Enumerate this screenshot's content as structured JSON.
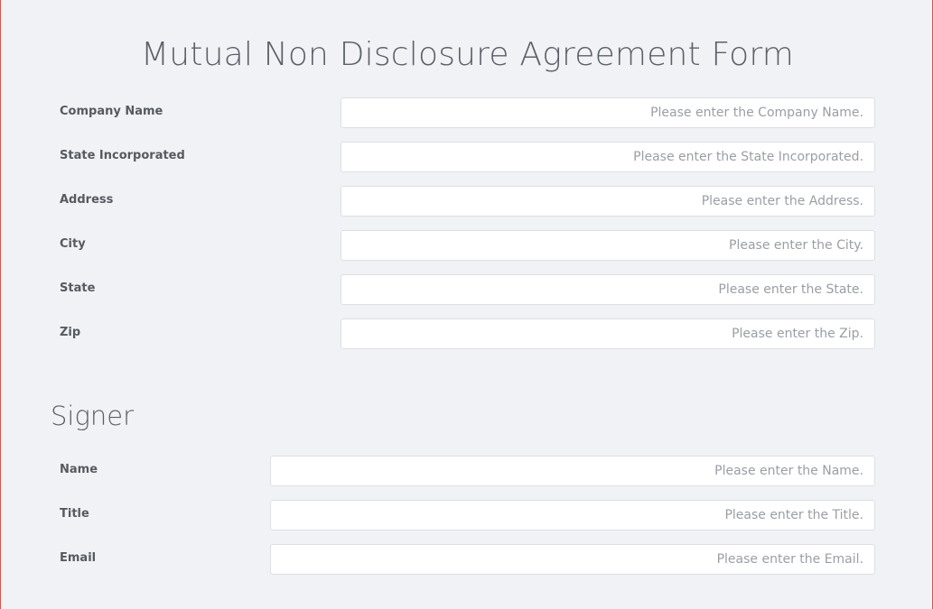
{
  "form": {
    "title": "Mutual Non Disclosure Agreement Form",
    "company_fields": [
      {
        "label": "Company Name",
        "placeholder": "Please enter the Company Name.",
        "value": ""
      },
      {
        "label": "State Incorporated",
        "placeholder": "Please enter the State Incorporated.",
        "value": ""
      },
      {
        "label": "Address",
        "placeholder": "Please enter the Address.",
        "value": ""
      },
      {
        "label": "City",
        "placeholder": "Please enter the City.",
        "value": ""
      },
      {
        "label": "State",
        "placeholder": "Please enter the State.",
        "value": ""
      },
      {
        "label": "Zip",
        "placeholder": "Please enter the Zip.",
        "value": ""
      }
    ],
    "signer": {
      "title": "Signer",
      "fields": [
        {
          "label": "Name",
          "placeholder": "Please enter the Name.",
          "value": ""
        },
        {
          "label": "Title",
          "placeholder": "Please enter the Title.",
          "value": ""
        },
        {
          "label": "Email",
          "placeholder": "Please enter the Email.",
          "value": ""
        }
      ]
    }
  },
  "colors": {
    "background": "#f1f2f5",
    "frame_border": "#d9534f",
    "text": "#555a61",
    "placeholder": "#9a9ea4",
    "input_border": "#dcdfe3"
  }
}
